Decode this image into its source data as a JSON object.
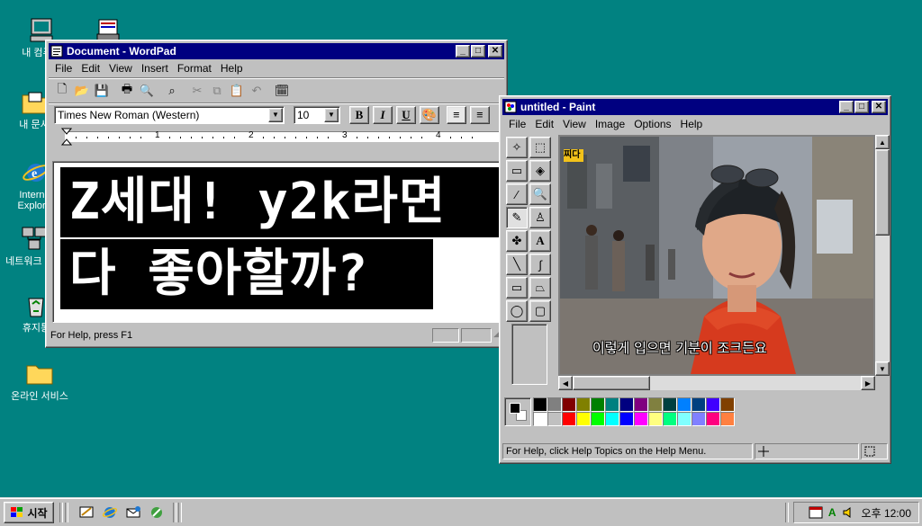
{
  "desktop": {
    "icons": [
      {
        "label": "내 컴퓨터",
        "icon": "my-computer-icon"
      },
      {
        "label": "",
        "icon": "inbox-icon"
      },
      {
        "label": "내 문서",
        "icon": "my-documents-icon"
      },
      {
        "label": "Internet Explorer",
        "icon": "internet-explorer-icon"
      },
      {
        "label": "네트워크 환경",
        "icon": "network-neighborhood-icon"
      },
      {
        "label": "휴지통",
        "icon": "recycle-bin-icon"
      },
      {
        "label": "온라인 서비스",
        "icon": "online-services-folder-icon"
      }
    ]
  },
  "wordpad": {
    "title": "Document - WordPad",
    "menu": [
      "File",
      "Edit",
      "View",
      "Insert",
      "Format",
      "Help"
    ],
    "font_name": "Times New Roman (Western)",
    "font_size": "10",
    "format_buttons": [
      "B",
      "I",
      "U"
    ],
    "ruler_numbers": [
      "1",
      "2",
      "3",
      "4"
    ],
    "text_line1": "Z세대! y2k라면",
    "text_line2": "다 좋아할까?",
    "status": "For Help, press F1"
  },
  "paint": {
    "title": "untitled - Paint",
    "menu": [
      "File",
      "Edit",
      "View",
      "Image",
      "Options",
      "Help"
    ],
    "subtitle_in_image": "이렇게 입으면 기분이 조크든요",
    "sign_in_image": "찌다",
    "palette_top": [
      "#000000",
      "#808080",
      "#800000",
      "#808000",
      "#008000",
      "#008080",
      "#000080",
      "#800080",
      "#808040",
      "#004040",
      "#0080ff",
      "#004080",
      "#4000ff",
      "#804000"
    ],
    "palette_bottom": [
      "#ffffff",
      "#c0c0c0",
      "#ff0000",
      "#ffff00",
      "#00ff00",
      "#00ffff",
      "#0000ff",
      "#ff00ff",
      "#ffff80",
      "#00ff80",
      "#80ffff",
      "#8080ff",
      "#ff0080",
      "#ff8040"
    ],
    "status": "For Help, click Help Topics on the Help Menu."
  },
  "taskbar": {
    "start_label": "시작",
    "clock": "오후 12:00",
    "tray_text": "A"
  },
  "colors": {
    "desktop": "#018281",
    "titlebar": "#000080",
    "window_face": "#c0c0c0"
  }
}
